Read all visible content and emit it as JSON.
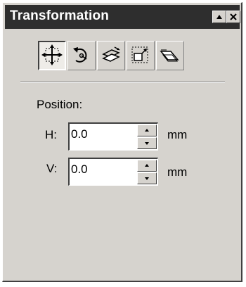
{
  "window": {
    "title": "Transformation",
    "rollup_icon": "rollup-triangle-icon",
    "close_icon": "close-x-icon"
  },
  "toolbar": {
    "tools": [
      {
        "name": "position",
        "icon": "position-move-icon",
        "pressed": true
      },
      {
        "name": "rotate",
        "icon": "rotate-icon",
        "pressed": false
      },
      {
        "name": "scale-mirror",
        "icon": "scale-mirror-icon",
        "pressed": false
      },
      {
        "name": "size",
        "icon": "size-icon",
        "pressed": false
      },
      {
        "name": "skew",
        "icon": "skew-icon",
        "pressed": false
      }
    ]
  },
  "position": {
    "heading": "Position:",
    "h": {
      "label": "H:",
      "value": "0.0",
      "unit": "mm"
    },
    "v": {
      "label": "V:",
      "value": "0.0",
      "unit": "mm"
    }
  },
  "colors": {
    "titlebar": "#2e2e2e",
    "panel": "#d6d3ce",
    "title_text": "#ffffff"
  }
}
